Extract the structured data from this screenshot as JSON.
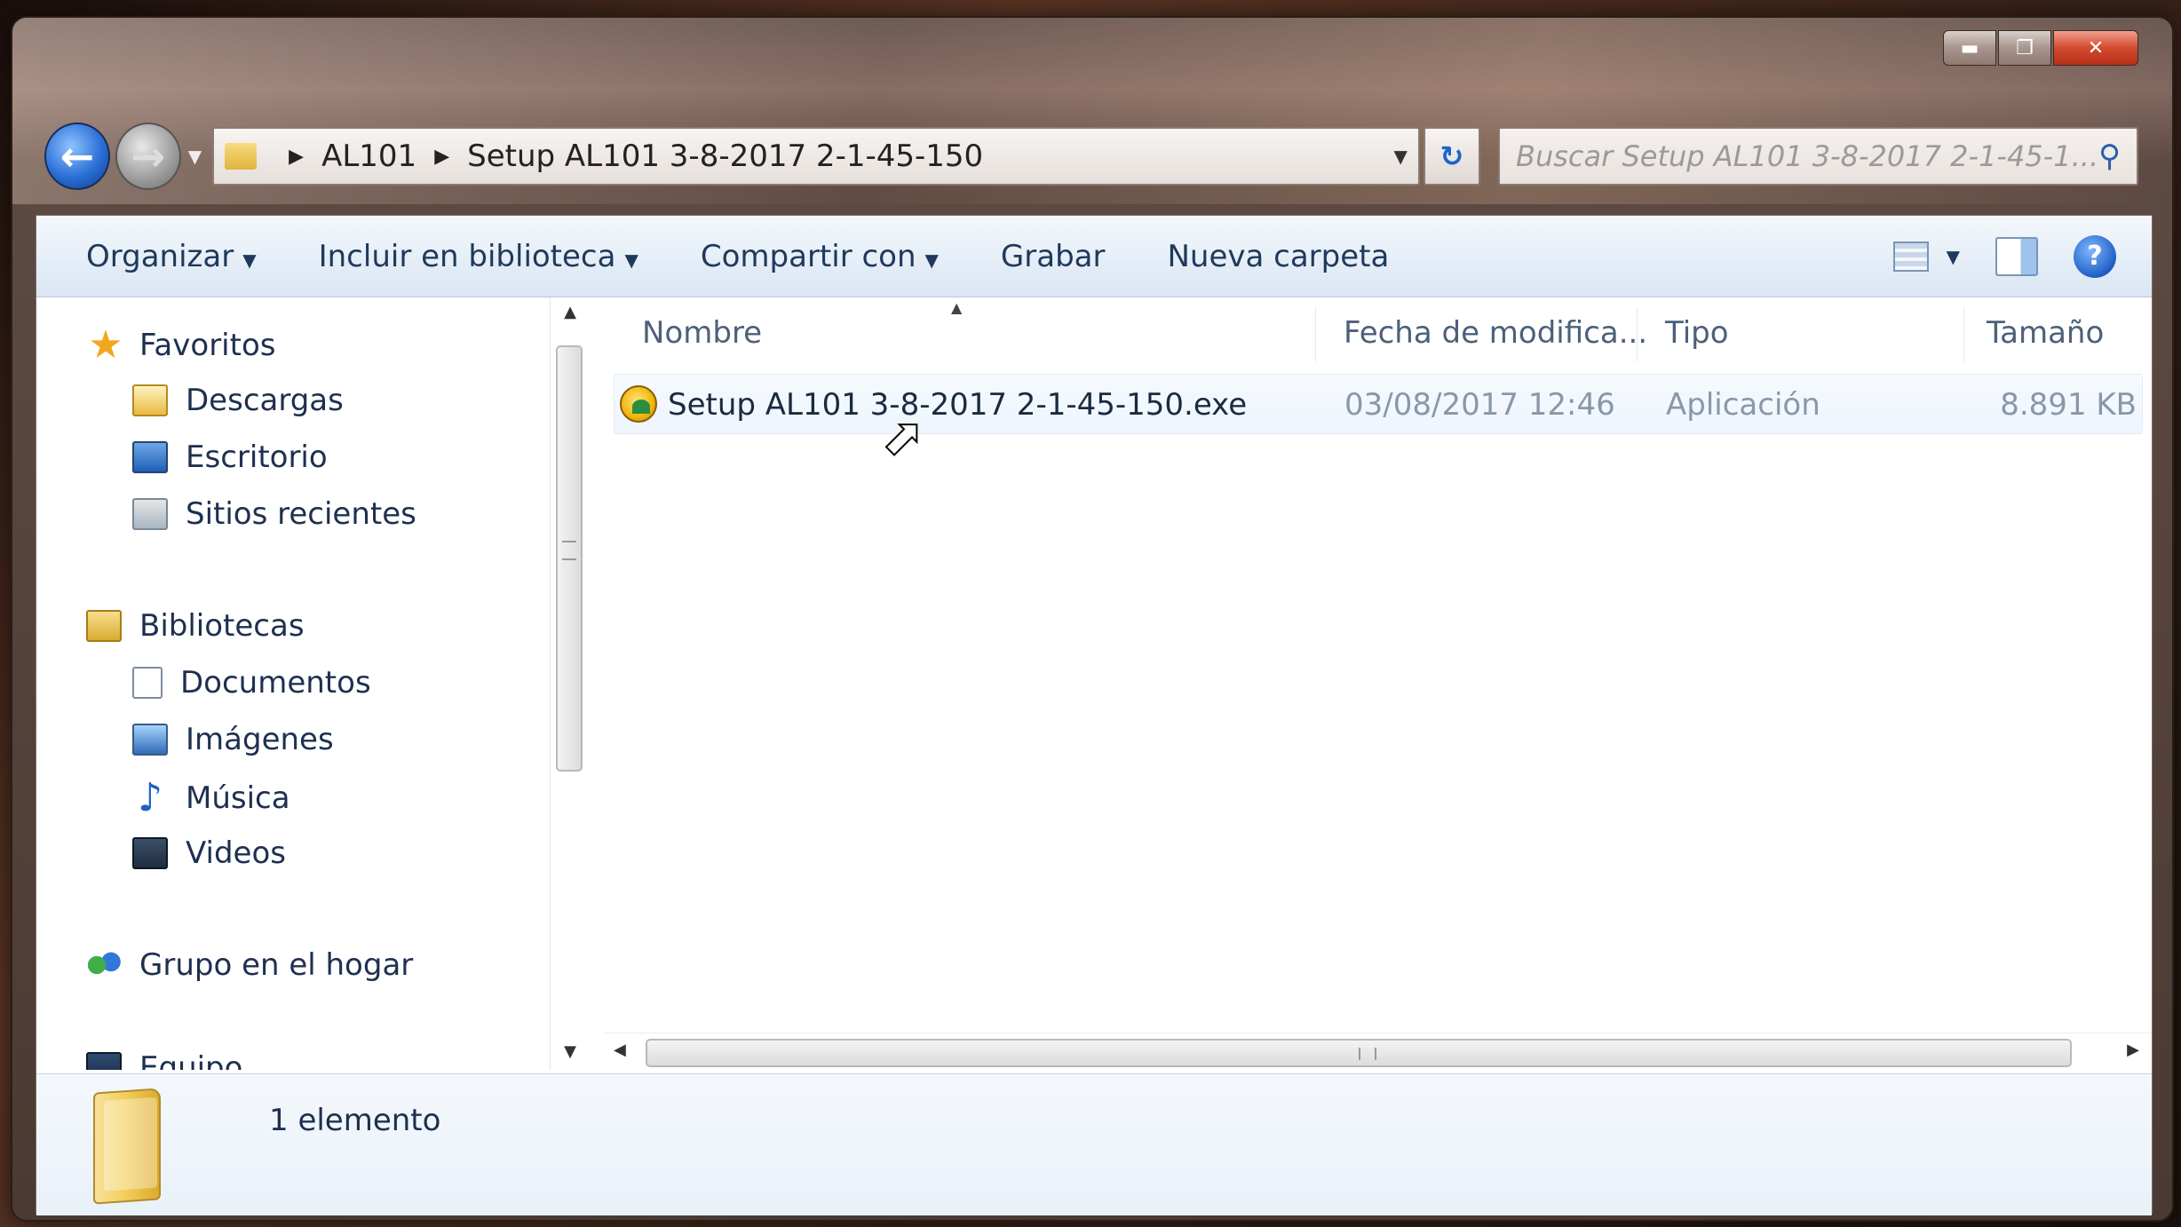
{
  "window": {
    "caption_buttons": {
      "minimize": "▬",
      "maximize": "❐",
      "close": "✕"
    }
  },
  "navigation": {
    "back_icon": "arrow-back-icon",
    "forward_icon": "arrow-forward-icon",
    "breadcrumb": [
      "AL101",
      "Setup AL101 3-8-2017 2-1-45-150"
    ],
    "search_placeholder": "Buscar Setup AL101 3-8-2017 2-1-45-1..."
  },
  "toolbar": {
    "organize": "Organizar",
    "include_library": "Incluir en biblioteca",
    "share_with": "Compartir con",
    "burn": "Grabar",
    "new_folder": "Nueva carpeta",
    "help": "?"
  },
  "navpane": {
    "favorites": "Favoritos",
    "downloads": "Descargas",
    "desktop": "Escritorio",
    "recent_places": "Sitios recientes",
    "libraries": "Bibliotecas",
    "documents": "Documentos",
    "pictures": "Imágenes",
    "music": "Música",
    "videos": "Videos",
    "homegroup": "Grupo en el hogar",
    "computer": "Equipo"
  },
  "columns": {
    "name": "Nombre",
    "date_modified": "Fecha de modifica...",
    "type": "Tipo",
    "size": "Tamaño"
  },
  "files": [
    {
      "name": "Setup AL101 3-8-2017 2-1-45-150.exe",
      "date": "03/08/2017 12:46",
      "type": "Aplicación",
      "size": "8.891 KB"
    }
  ],
  "details": {
    "item_count": "1 elemento"
  }
}
